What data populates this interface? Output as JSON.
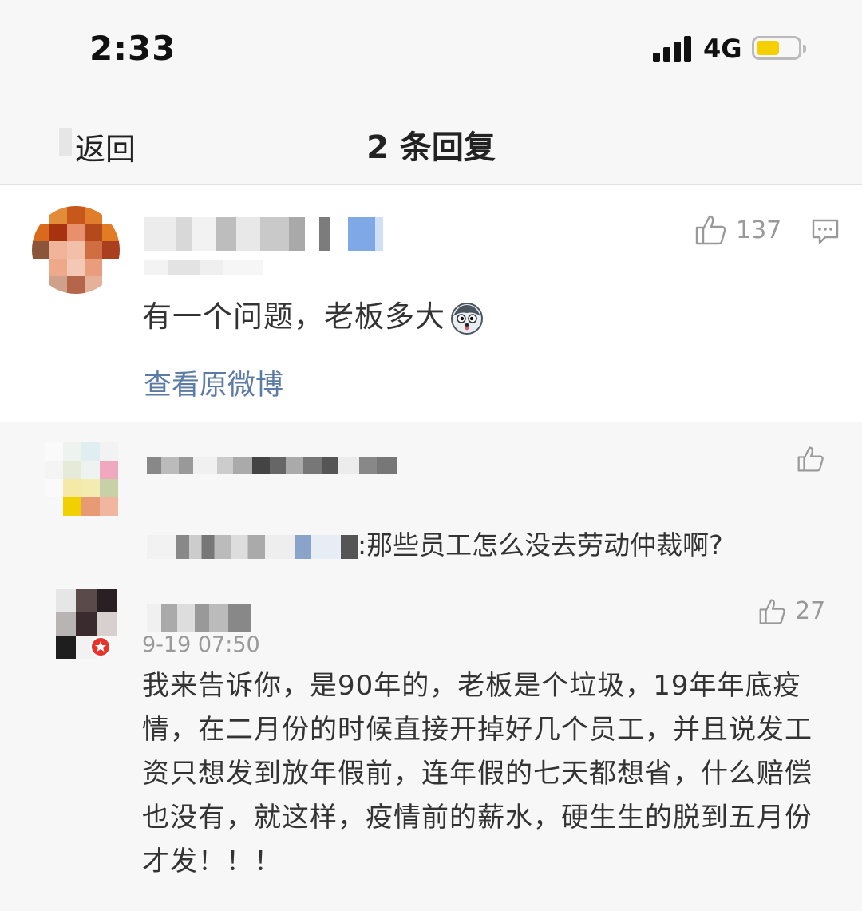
{
  "status_bar": {
    "time": "2:33",
    "network": "4G",
    "battery_level": 0.55,
    "battery_color": "#f5d000"
  },
  "nav": {
    "back_label": "返回",
    "title": "2 条回复"
  },
  "main_comment": {
    "text": "有一个问题，老板多大",
    "emoji": "husky-emoji",
    "likes": "137",
    "view_original_label": "查看原微博",
    "link_color": "#5b7ba6"
  },
  "replies": [
    {
      "text": ":那些员工怎么没去劳动仲裁啊?"
    },
    {
      "likes": "27",
      "timestamp": "9-19 07:50",
      "text": "我来告诉你，是90年的，老板是个垃圾，19年年底疫情，在二月份的时候直接开掉好几个员工，并且说发工资只想发到放年假前，连年假的七天都想省，什么赔偿也没有，就这样，疫情前的薪水，硬生生的脱到五月份才发！！！"
    }
  ],
  "icons": {
    "like": "thumbs-up-icon",
    "comment": "comment-icon",
    "badge": "red-star-badge-icon"
  }
}
